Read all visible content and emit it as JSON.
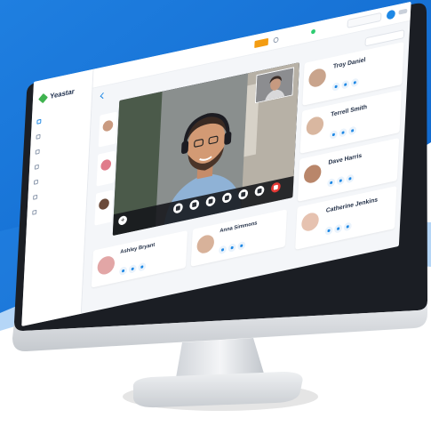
{
  "app": {
    "brand": "Yeastar",
    "accent_color": "#1e88e5"
  },
  "topbar": {
    "badge": "",
    "status_1": "",
    "status_2": "",
    "search_placeholder": "",
    "user_label": "",
    "filter_placeholder": ""
  },
  "sidebar": {
    "items": [
      {
        "label": "",
        "icon": "contacts-icon",
        "active": true
      },
      {
        "label": "",
        "icon": "calls-icon",
        "active": false
      },
      {
        "label": "",
        "icon": "conference-icon",
        "active": false
      },
      {
        "label": "",
        "icon": "voicemail-icon",
        "active": false
      },
      {
        "label": "",
        "icon": "recordings-icon",
        "active": false
      },
      {
        "label": "",
        "icon": "meetings-icon",
        "active": false
      },
      {
        "label": "",
        "icon": "settings-icon",
        "active": false
      }
    ]
  },
  "call_panel": {
    "breadcrumb": "",
    "call_label": "",
    "controls": [
      {
        "icon": "video-icon",
        "label": ""
      },
      {
        "icon": "mic-icon",
        "label": ""
      },
      {
        "icon": "hold-icon",
        "label": ""
      },
      {
        "icon": "keypad-icon",
        "label": ""
      },
      {
        "icon": "record-icon",
        "label": ""
      },
      {
        "icon": "transfer-icon",
        "label": ""
      },
      {
        "icon": "hangup-icon",
        "label": ""
      }
    ],
    "add_label": ""
  },
  "contacts_right": [
    {
      "name": "Troy Daniel",
      "ext": ""
    },
    {
      "name": "Terrell Smith",
      "ext": ""
    },
    {
      "name": "Dave Harris",
      "ext": ""
    },
    {
      "name": "Catherine Jenkins",
      "ext": ""
    }
  ],
  "contacts_bottom": [
    {
      "name": "Ashley Bryant",
      "ext": ""
    },
    {
      "name": "Anna Simmons",
      "ext": ""
    }
  ]
}
